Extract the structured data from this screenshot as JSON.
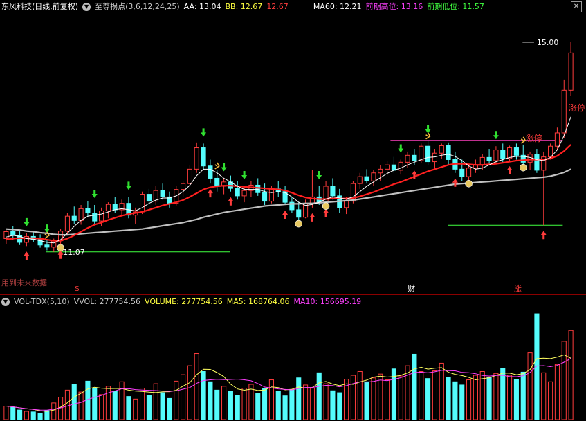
{
  "header": {
    "stock_name": "东风科技",
    "period": "(日线,前复权)",
    "indicator_name": "至尊拐点",
    "indicator_params": "(3,6,12,24,25)",
    "aa": "AA: 13.04",
    "bb": "BB: 12.67",
    "bb_value2": "12.67",
    "ma60": "MA60: 12.21",
    "prev_high": "前期高位: 13.16",
    "prev_low": "前期低位: 11.57"
  },
  "annotations": {
    "high_label": "15.00",
    "low_label": "11.07",
    "future_data_note": "用到未来数据",
    "limit_up_right": "涨停",
    "limit_up_mid": "涨停",
    "axis_marker_s": "$",
    "axis_marker_cai": "财",
    "axis_marker_zhang": "涨"
  },
  "volume_header": {
    "name": "VOL-TDX",
    "params": "(5,10)",
    "vvol": "VVOL: 277754.56",
    "volume": "VOLUME: 277754.56",
    "ma5": "MA5: 168764.06",
    "ma10": "MA10: 156695.19"
  },
  "colors": {
    "up": "#ff3c3c",
    "down": "#54fcfc",
    "ma_white": "#ffffff",
    "ma_red": "#ff2020",
    "ma_gray": "#c0c0c0",
    "ma_green": "#30e030",
    "vol_ma5": "#ffff60",
    "vol_ma10": "#ff40ff",
    "level_pink": "#ff40c0",
    "level_green": "#40ff40"
  },
  "chart_data": [
    {
      "type": "candlestick",
      "title": "",
      "y_range": [
        10.6,
        15.35
      ],
      "levels": [
        {
          "kind": "prev_high",
          "value": 13.16
        },
        {
          "kind": "prev_low",
          "value": 11.57
        },
        {
          "kind": "low",
          "value": 11.07
        },
        {
          "kind": "high",
          "value": 15.0
        }
      ],
      "ohlc": [
        [
          11.32,
          11.48,
          11.22,
          11.45
        ],
        [
          11.45,
          11.55,
          11.3,
          11.38
        ],
        [
          11.38,
          11.47,
          11.2,
          11.25
        ],
        [
          11.25,
          11.42,
          11.18,
          11.36
        ],
        [
          11.36,
          11.44,
          11.26,
          11.3
        ],
        [
          11.3,
          11.4,
          11.15,
          11.2
        ],
        [
          11.2,
          11.3,
          11.1,
          11.16
        ],
        [
          11.16,
          11.32,
          11.07,
          11.28
        ],
        [
          11.28,
          11.5,
          11.2,
          11.46
        ],
        [
          11.46,
          11.8,
          11.4,
          11.74
        ],
        [
          11.74,
          11.92,
          11.6,
          11.66
        ],
        [
          11.66,
          11.95,
          11.58,
          11.88
        ],
        [
          11.88,
          12.02,
          11.72,
          11.8
        ],
        [
          11.8,
          11.95,
          11.6,
          11.65
        ],
        [
          11.65,
          11.9,
          11.55,
          11.84
        ],
        [
          11.84,
          12.0,
          11.7,
          11.96
        ],
        [
          11.96,
          12.1,
          11.8,
          11.86
        ],
        [
          11.86,
          12.05,
          11.75,
          11.98
        ],
        [
          11.98,
          12.1,
          11.7,
          11.76
        ],
        [
          11.76,
          11.9,
          11.6,
          11.82
        ],
        [
          11.82,
          12.2,
          11.78,
          12.15
        ],
        [
          12.15,
          12.25,
          11.95,
          12.02
        ],
        [
          12.02,
          12.3,
          11.95,
          12.22
        ],
        [
          12.22,
          12.35,
          12.05,
          12.1
        ],
        [
          12.1,
          12.2,
          11.9,
          11.98
        ],
        [
          11.98,
          12.3,
          11.94,
          12.24
        ],
        [
          12.24,
          12.4,
          12.1,
          12.35
        ],
        [
          12.35,
          12.7,
          12.3,
          12.62
        ],
        [
          12.62,
          13.12,
          12.55,
          13.02
        ],
        [
          13.02,
          13.1,
          12.6,
          12.68
        ],
        [
          12.68,
          12.8,
          12.35,
          12.45
        ],
        [
          12.45,
          12.6,
          12.2,
          12.3
        ],
        [
          12.3,
          12.45,
          12.15,
          12.38
        ],
        [
          12.38,
          12.5,
          12.2,
          12.26
        ],
        [
          12.26,
          12.4,
          12.05,
          12.12
        ],
        [
          12.12,
          12.3,
          12.0,
          12.22
        ],
        [
          12.22,
          12.4,
          12.1,
          12.32
        ],
        [
          12.32,
          12.45,
          12.12,
          12.18
        ],
        [
          12.18,
          12.35,
          11.95,
          12.02
        ],
        [
          12.02,
          12.3,
          11.98,
          12.25
        ],
        [
          12.25,
          12.4,
          12.1,
          12.2
        ],
        [
          12.2,
          12.3,
          11.95,
          12.0
        ],
        [
          12.0,
          12.1,
          11.8,
          11.86
        ],
        [
          11.86,
          12.0,
          11.65,
          11.72
        ],
        [
          11.72,
          12.05,
          11.7,
          11.98
        ],
        [
          11.98,
          12.6,
          11.9,
          12.1
        ],
        [
          12.1,
          12.3,
          11.95,
          12.0
        ],
        [
          12.0,
          12.4,
          11.98,
          12.3
        ],
        [
          12.3,
          12.45,
          12.05,
          12.12
        ],
        [
          12.12,
          12.25,
          11.8,
          11.9
        ],
        [
          11.9,
          12.1,
          11.78,
          12.02
        ],
        [
          12.02,
          12.4,
          11.98,
          12.35
        ],
        [
          12.35,
          12.55,
          12.25,
          12.48
        ],
        [
          12.48,
          12.62,
          12.35,
          12.4
        ],
        [
          12.4,
          12.6,
          12.3,
          12.55
        ],
        [
          12.55,
          12.7,
          12.4,
          12.62
        ],
        [
          12.62,
          12.78,
          12.5,
          12.7
        ],
        [
          12.7,
          12.85,
          12.55,
          12.6
        ],
        [
          12.6,
          12.8,
          12.52,
          12.75
        ],
        [
          12.75,
          12.95,
          12.65,
          12.88
        ],
        [
          12.88,
          13.0,
          12.7,
          12.78
        ],
        [
          12.78,
          13.1,
          12.74,
          13.05
        ],
        [
          13.05,
          13.16,
          12.7,
          12.76
        ],
        [
          12.76,
          13.0,
          12.6,
          12.92
        ],
        [
          12.92,
          13.1,
          12.82,
          13.06
        ],
        [
          13.06,
          13.12,
          12.7,
          12.8
        ],
        [
          12.8,
          12.95,
          12.55,
          12.62
        ],
        [
          12.62,
          12.8,
          12.4,
          12.48
        ],
        [
          12.48,
          12.7,
          12.4,
          12.64
        ],
        [
          12.64,
          12.8,
          12.55,
          12.7
        ],
        [
          12.7,
          12.9,
          12.6,
          12.84
        ],
        [
          12.84,
          13.0,
          12.72,
          12.78
        ],
        [
          12.78,
          13.05,
          12.74,
          12.98
        ],
        [
          12.98,
          13.1,
          12.75,
          12.82
        ],
        [
          12.82,
          13.06,
          12.78,
          13.02
        ],
        [
          13.02,
          13.1,
          12.8,
          12.88
        ],
        [
          12.88,
          13.08,
          12.7,
          12.75
        ],
        [
          12.75,
          12.95,
          12.6,
          12.9
        ],
        [
          12.9,
          13.0,
          12.55,
          12.6
        ],
        [
          12.6,
          12.95,
          11.57,
          12.85
        ],
        [
          12.85,
          13.1,
          12.8,
          13.05
        ],
        [
          13.05,
          13.4,
          12.98,
          13.3
        ],
        [
          13.3,
          14.3,
          13.2,
          14.1
        ],
        [
          14.1,
          15.0,
          14.0,
          14.8
        ]
      ],
      "ma_white": [
        11.35,
        11.38,
        11.36,
        11.32,
        11.31,
        11.28,
        11.25,
        11.24,
        11.3,
        11.42,
        11.55,
        11.66,
        11.74,
        11.76,
        11.78,
        11.82,
        11.86,
        11.88,
        11.86,
        11.84,
        11.9,
        11.98,
        12.04,
        12.08,
        12.08,
        12.12,
        12.2,
        12.32,
        12.5,
        12.62,
        12.62,
        12.55,
        12.45,
        12.38,
        12.3,
        12.24,
        12.24,
        12.24,
        12.2,
        12.18,
        12.2,
        12.18,
        12.1,
        12.0,
        11.94,
        11.96,
        12.0,
        12.06,
        12.1,
        12.08,
        12.06,
        12.1,
        12.2,
        12.3,
        12.38,
        12.46,
        12.54,
        12.6,
        12.64,
        12.7,
        12.75,
        12.8,
        12.84,
        12.85,
        12.88,
        12.9,
        12.86,
        12.78,
        12.68,
        12.62,
        12.64,
        12.7,
        12.76,
        12.8,
        12.84,
        12.86,
        12.86,
        12.84,
        12.8,
        12.78,
        12.84,
        12.98,
        13.25,
        13.6
      ],
      "ma_red": [
        11.3,
        11.32,
        11.33,
        11.33,
        11.33,
        11.32,
        11.3,
        11.28,
        11.28,
        11.32,
        11.38,
        11.45,
        11.52,
        11.58,
        11.62,
        11.67,
        11.71,
        11.75,
        11.78,
        11.8,
        11.82,
        11.86,
        11.9,
        11.94,
        11.97,
        12.0,
        12.04,
        12.1,
        12.17,
        12.24,
        12.28,
        12.3,
        12.31,
        12.31,
        12.3,
        12.29,
        12.28,
        12.27,
        12.26,
        12.25,
        12.24,
        12.22,
        12.18,
        12.13,
        12.09,
        12.07,
        12.06,
        12.06,
        12.07,
        12.07,
        12.07,
        12.08,
        12.11,
        12.15,
        12.19,
        12.24,
        12.29,
        12.34,
        12.38,
        12.43,
        12.48,
        12.53,
        12.58,
        12.62,
        12.66,
        12.7,
        12.72,
        12.72,
        12.71,
        12.7,
        12.7,
        12.71,
        12.72,
        12.74,
        12.76,
        12.78,
        12.79,
        12.8,
        12.8,
        12.8,
        12.82,
        12.87,
        12.96,
        13.08
      ],
      "ma_gray": [
        11.5,
        11.49,
        11.48,
        11.46,
        11.45,
        11.43,
        11.42,
        11.4,
        11.39,
        11.39,
        11.4,
        11.41,
        11.42,
        11.43,
        11.44,
        11.45,
        11.46,
        11.47,
        11.48,
        11.49,
        11.5,
        11.52,
        11.54,
        11.56,
        11.58,
        11.6,
        11.62,
        11.65,
        11.68,
        11.72,
        11.75,
        11.78,
        11.81,
        11.83,
        11.85,
        11.87,
        11.89,
        11.91,
        11.93,
        11.94,
        11.95,
        11.96,
        11.97,
        11.97,
        11.98,
        11.98,
        11.99,
        12.0,
        12.01,
        12.02,
        12.03,
        12.04,
        12.06,
        12.08,
        12.1,
        12.12,
        12.14,
        12.16,
        12.18,
        12.2,
        12.22,
        12.24,
        12.26,
        12.28,
        12.3,
        12.32,
        12.34,
        12.35,
        12.36,
        12.37,
        12.38,
        12.39,
        12.4,
        12.41,
        12.42,
        12.43,
        12.44,
        12.45,
        12.46,
        12.47,
        12.49,
        12.52,
        12.56,
        12.62
      ]
    },
    {
      "type": "bar",
      "title": "",
      "series": [
        {
          "values": [
            42000,
            38000,
            30000,
            26000,
            24000,
            20000,
            28000,
            52000,
            70000,
            92000,
            110000,
            86000,
            120000,
            96000,
            78000,
            104000,
            88000,
            118000,
            72000,
            64000,
            98000,
            76000,
            112000,
            84000,
            66000,
            120000,
            140000,
            168000,
            206000,
            150000,
            118000,
            92000,
            104000,
            88000,
            76000,
            98000,
            110000,
            82000,
            96000,
            124000,
            88000,
            74000,
            92000,
            130000,
            108000,
            98000,
            146000,
            112000,
            90000,
            84000,
            126000,
            138000,
            150000,
            118000,
            130000,
            142000,
            124000,
            158000,
            136000,
            168000,
            204000,
            150000,
            128000,
            152000,
            176000,
            132000,
            118000,
            108000,
            124000,
            138000,
            150000,
            132000,
            144000,
            160000,
            138000,
            126000,
            148000,
            208000,
            330000,
            146000,
            118000,
            172000,
            244000,
            277754
          ]
        }
      ]
    }
  ]
}
